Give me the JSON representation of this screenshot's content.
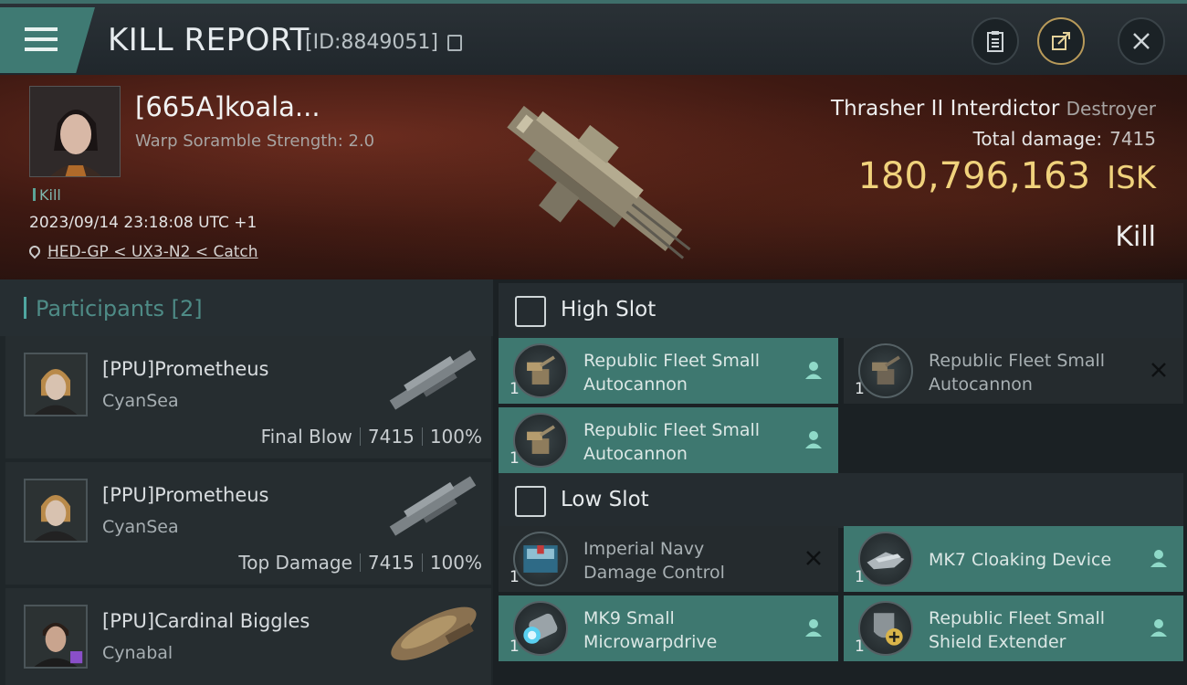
{
  "header": {
    "title": "KILL REPORT",
    "report_id": "[ID:8849051]"
  },
  "victim": {
    "name": "[665A]koala...",
    "warp_scramble": "Warp Soramble Strength: 2.0",
    "tag": "Kill",
    "timestamp": "2023/09/14 23:18:08 UTC +1",
    "location": "HED-GP < UX3-N2 < Catch",
    "ship_name": "Thrasher II Interdictor",
    "ship_class": "Destroyer",
    "total_damage_label": "Total damage:",
    "total_damage": "7415",
    "isk_value": "180,796,163",
    "isk_unit": "ISK",
    "result": "Kill"
  },
  "participants": {
    "title": "Participants [2]",
    "items": [
      {
        "name": "[PPU]Prometheus",
        "corp": "CyanSea",
        "role": "Final Blow",
        "damage": "7415",
        "percent": "100%"
      },
      {
        "name": "[PPU]Prometheus",
        "corp": "CyanSea",
        "role": "Top Damage",
        "damage": "7415",
        "percent": "100%"
      },
      {
        "name": "[PPU]Cardinal Biggles",
        "corp": "Cynabal"
      }
    ]
  },
  "slots": {
    "high": {
      "label": "High Slot",
      "modules": [
        {
          "line1": "Republic Fleet Small",
          "line2": "Autocannon",
          "qty": "1",
          "status": "fitted"
        },
        {
          "line1": "Republic Fleet Small",
          "line2": "Autocannon",
          "qty": "1",
          "status": "destroyed"
        },
        {
          "line1": "Republic Fleet Small",
          "line2": "Autocannon",
          "qty": "1",
          "status": "fitted"
        }
      ]
    },
    "low": {
      "label": "Low Slot",
      "modules": [
        {
          "line1": "Imperial Navy",
          "line2": "Damage Control",
          "qty": "1",
          "status": "destroyed"
        },
        {
          "line1": "MK7 Cloaking Device",
          "line2": "",
          "qty": "1",
          "status": "fitted"
        },
        {
          "line1": "MK9 Small",
          "line2": "Microwarpdrive",
          "qty": "1",
          "status": "fitted"
        },
        {
          "line1": "Republic Fleet Small",
          "line2": "Shield Extender",
          "qty": "1",
          "status": "fitted"
        }
      ]
    }
  },
  "colors": {
    "accent_teal": "#3e7870",
    "isk_gold": "#f0d27c",
    "banner_red": "#6b2c1f"
  }
}
